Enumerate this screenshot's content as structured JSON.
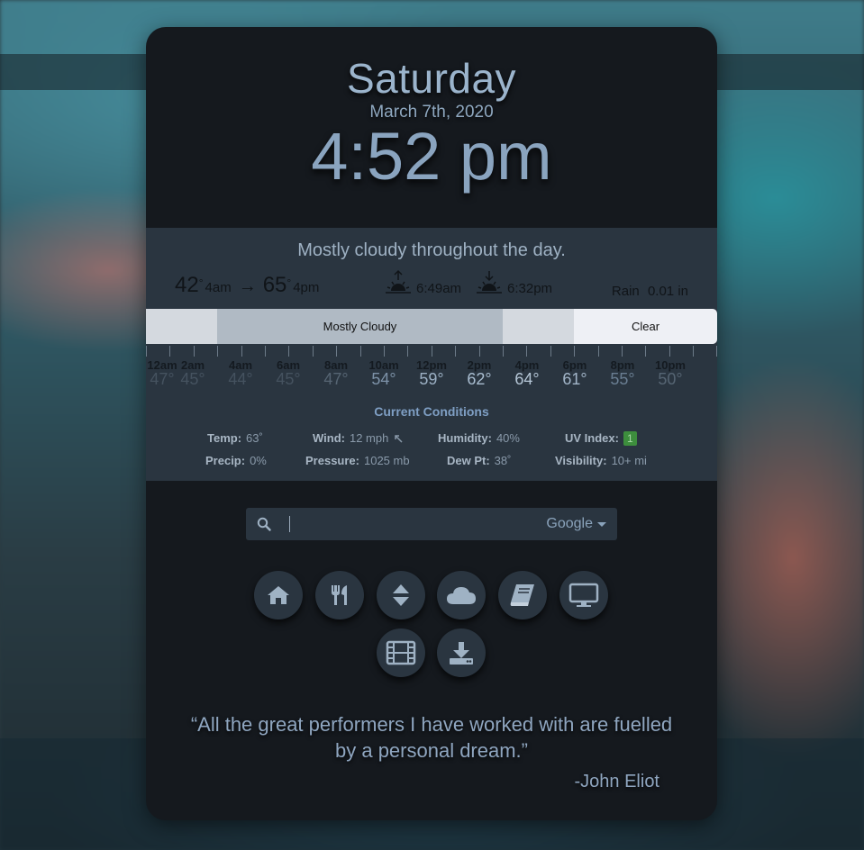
{
  "header": {
    "day": "Saturday",
    "date": "March 7th, 2020",
    "time": "4:52 pm"
  },
  "weather": {
    "summary": "Mostly cloudy throughout the day.",
    "low_temp": "42",
    "low_time": "4am",
    "arrow": "→",
    "high_temp": "65",
    "high_time": "4pm",
    "degree": "°",
    "sunrise": "6:49am",
    "sunset": "6:32pm",
    "rain_label": "Rain",
    "rain_value": "0.01 in",
    "bar": {
      "cloudy_label": "Mostly Cloudy",
      "clear_label": "Clear"
    },
    "hours": [
      {
        "label": "12am",
        "temp": "47°"
      },
      {
        "label": "2am",
        "temp": "45°"
      },
      {
        "label": "4am",
        "temp": "44°"
      },
      {
        "label": "6am",
        "temp": "45°"
      },
      {
        "label": "8am",
        "temp": "47°"
      },
      {
        "label": "10am",
        "temp": "54°"
      },
      {
        "label": "12pm",
        "temp": "59°"
      },
      {
        "label": "2pm",
        "temp": "62°"
      },
      {
        "label": "4pm",
        "temp": "64°"
      },
      {
        "label": "6pm",
        "temp": "61°"
      },
      {
        "label": "8pm",
        "temp": "55°"
      },
      {
        "label": "10pm",
        "temp": "50°"
      }
    ],
    "current": {
      "title": "Current Conditions",
      "temp_label": "Temp:",
      "temp_value": "63˚",
      "wind_label": "Wind:",
      "wind_value": "12 mph",
      "humidity_label": "Humidity:",
      "humidity_value": "40%",
      "uv_label": "UV Index:",
      "uv_value": "1",
      "precip_label": "Precip:",
      "precip_value": "0%",
      "pressure_label": "Pressure:",
      "pressure_value": "1025 mb",
      "dewpt_label": "Dew Pt:",
      "dewpt_value": "38˚",
      "visibility_label": "Visibility:",
      "visibility_value": "10+ mi"
    }
  },
  "search": {
    "engine": "Google"
  },
  "icons": [
    "home-icon",
    "utensils-icon",
    "sort-icon",
    "cloud-icon",
    "book-icon",
    "monitor-icon",
    "film-icon",
    "download-icon"
  ],
  "quote": {
    "text": "“All the great performers I have worked with are fuelled by a personal dream.”",
    "author": "-John Eliot"
  },
  "colors": {
    "card": "#15191e",
    "panel": "#2a3540",
    "accent": "#8aa3bb",
    "uv_badge": "#3d8e3d"
  }
}
